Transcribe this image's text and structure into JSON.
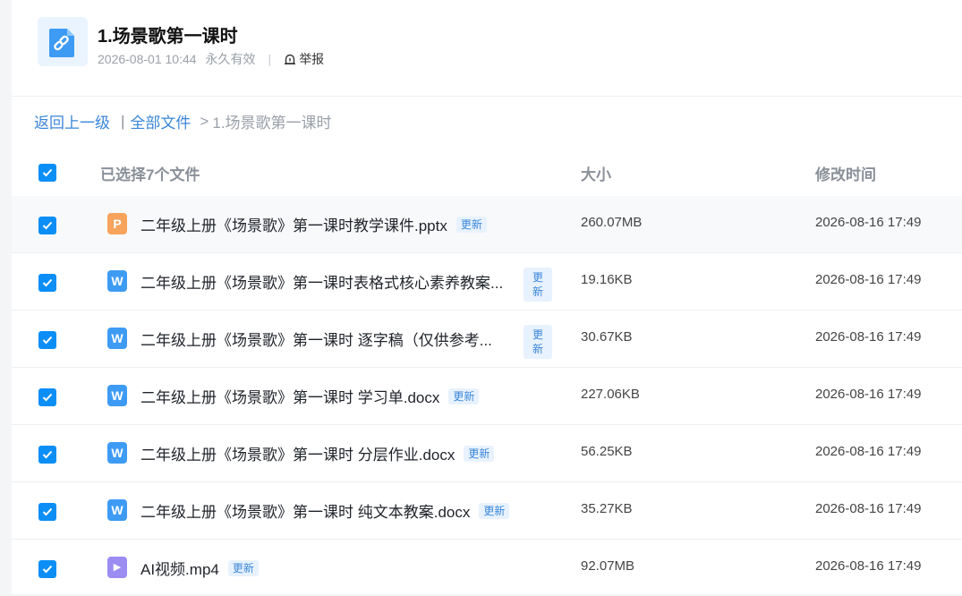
{
  "header": {
    "title": "1.场景歌第一课时",
    "date": "2026-08-01 10:44",
    "validity": "永久有效",
    "separator": "|",
    "report_label": "举报",
    "accent": "#3a86d8"
  },
  "breadcrumb": {
    "back": "返回上一级",
    "divider": "|",
    "all_files": "全部文件",
    "chevron": ">",
    "current": "1.场景歌第一课时"
  },
  "table": {
    "selected_label": "已选择7个文件",
    "size_header": "大小",
    "modified_header": "修改时间",
    "rows": [
      {
        "name": "二年级上册《场景歌》第一课时教学课件.pptx",
        "badge": "更新",
        "size": "260.07MB",
        "date": "2026-08-16 17:49",
        "icon": "ppt-file-icon",
        "icon_letter": "P",
        "icon_color": "#f7a35c"
      },
      {
        "name": "二年级上册《场景歌》第一课时表格式核心素养教案...",
        "badge": "更新",
        "size": "19.16KB",
        "date": "2026-08-16 17:49",
        "icon": "word-file-icon",
        "icon_letter": "W",
        "icon_color": "#3e9bf4"
      },
      {
        "name": "二年级上册《场景歌》第一课时 逐字稿（仅供参考...",
        "badge": "更新",
        "size": "30.67KB",
        "date": "2026-08-16 17:49",
        "icon": "word-file-icon",
        "icon_letter": "W",
        "icon_color": "#3e9bf4"
      },
      {
        "name": "二年级上册《场景歌》第一课时 学习单.docx",
        "badge": "更新",
        "size": "227.06KB",
        "date": "2026-08-16 17:49",
        "icon": "word-file-icon",
        "icon_letter": "W",
        "icon_color": "#3e9bf4"
      },
      {
        "name": "二年级上册《场景歌》第一课时 分层作业.docx",
        "badge": "更新",
        "size": "56.25KB",
        "date": "2026-08-16 17:49",
        "icon": "word-file-icon",
        "icon_letter": "W",
        "icon_color": "#3e9bf4"
      },
      {
        "name": "二年级上册《场景歌》第一课时 纯文本教案.docx",
        "badge": "更新",
        "size": "35.27KB",
        "date": "2026-08-16 17:49",
        "icon": "word-file-icon",
        "icon_letter": "W",
        "icon_color": "#3e9bf4"
      },
      {
        "name": "AI视频.mp4",
        "badge": "更新",
        "size": "92.07MB",
        "date": "2026-08-16 17:49",
        "icon": "video-file-icon",
        "icon_letter": "▶",
        "icon_color": "#9b8cf2"
      }
    ]
  }
}
